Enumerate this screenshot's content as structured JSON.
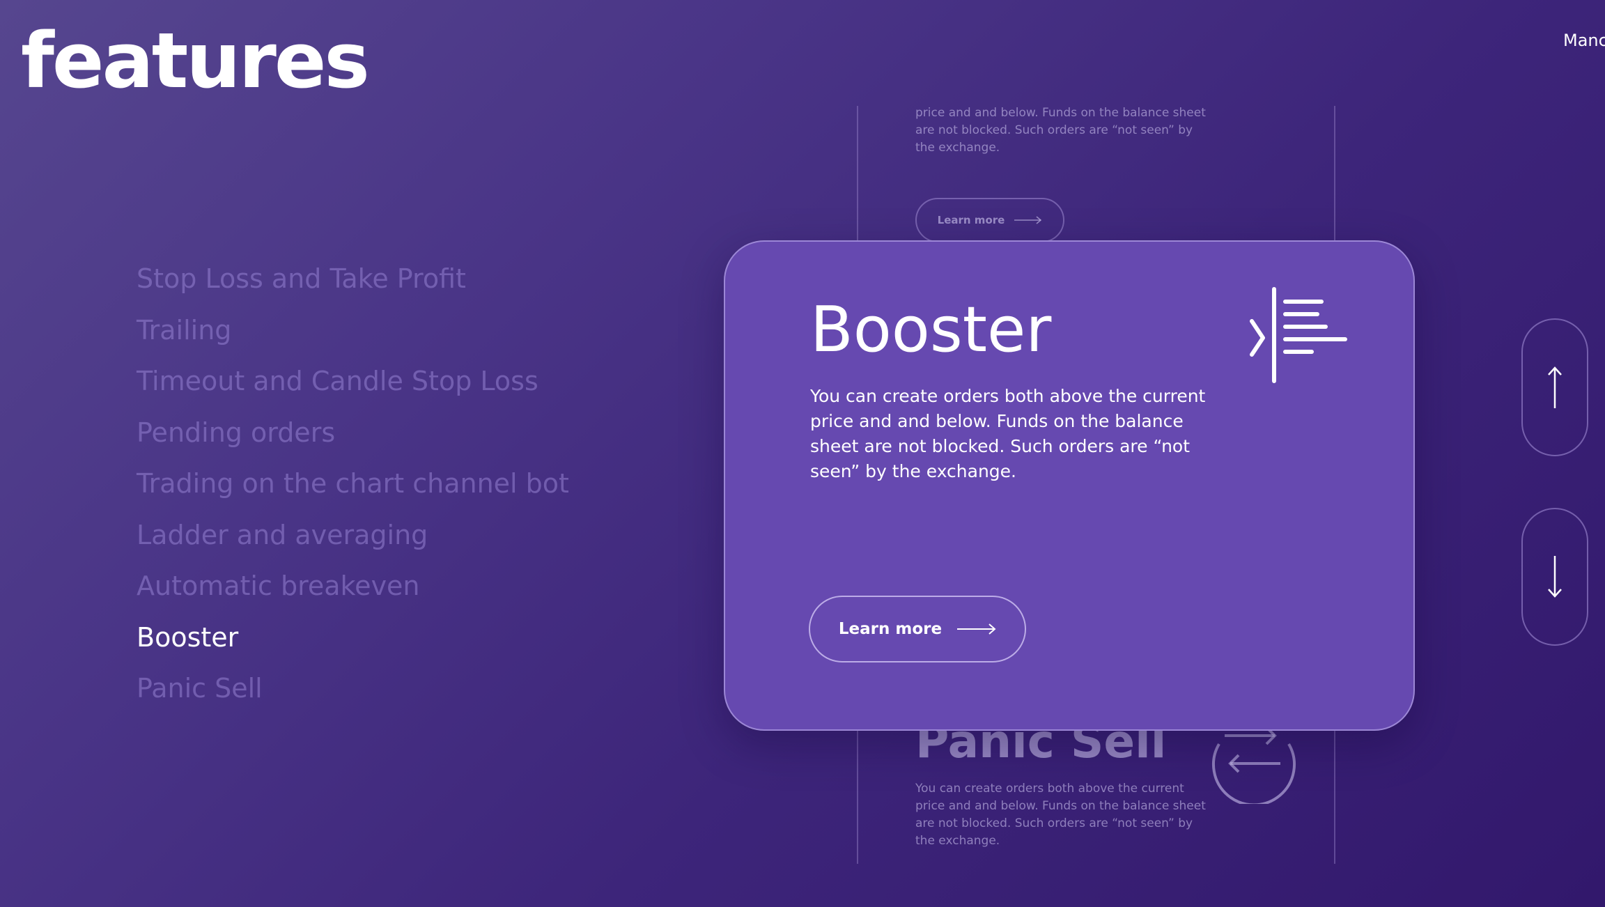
{
  "header": {
    "title": "features",
    "top_right": "Manc"
  },
  "features_nav": {
    "items": [
      {
        "label": "Stop Loss and Take Profit"
      },
      {
        "label": "Trailing"
      },
      {
        "label": "Timeout and Candle Stop Loss"
      },
      {
        "label": "Pending orders"
      },
      {
        "label": "Trading on the chart channel bot"
      },
      {
        "label": "Ladder and averaging"
      },
      {
        "label": "Automatic breakeven"
      },
      {
        "label": "Booster"
      },
      {
        "label": "Panic Sell"
      }
    ],
    "active": "Booster"
  },
  "carousel": {
    "previous_card": {
      "description": "price and and below. Funds on the balance sheet are not blocked. Such orders are “not seen” by the exchange.",
      "learn_more": "Learn more"
    },
    "active_card": {
      "title": "Booster",
      "description": "You can create orders both above the current price and and below. Funds on the balance sheet are not blocked. Such orders are “not seen” by the exchange.",
      "learn_more": "Learn more",
      "icon": "booster-icon"
    },
    "next_card": {
      "title": "Panic Sell",
      "description": "You can create orders both above the current price and and below. Funds on the balance sheet are not blocked. Such orders are “not seen” by the exchange.",
      "icon": "exchange-arrows-icon"
    }
  },
  "controls": {
    "up_icon": "arrow-up-icon",
    "down_icon": "arrow-down-icon"
  },
  "colors": {
    "background_start": "#56468f",
    "background_end": "#32186c",
    "card": "#6649b0",
    "inactive_text": "#8a76c8",
    "active_text": "#ffffff"
  }
}
